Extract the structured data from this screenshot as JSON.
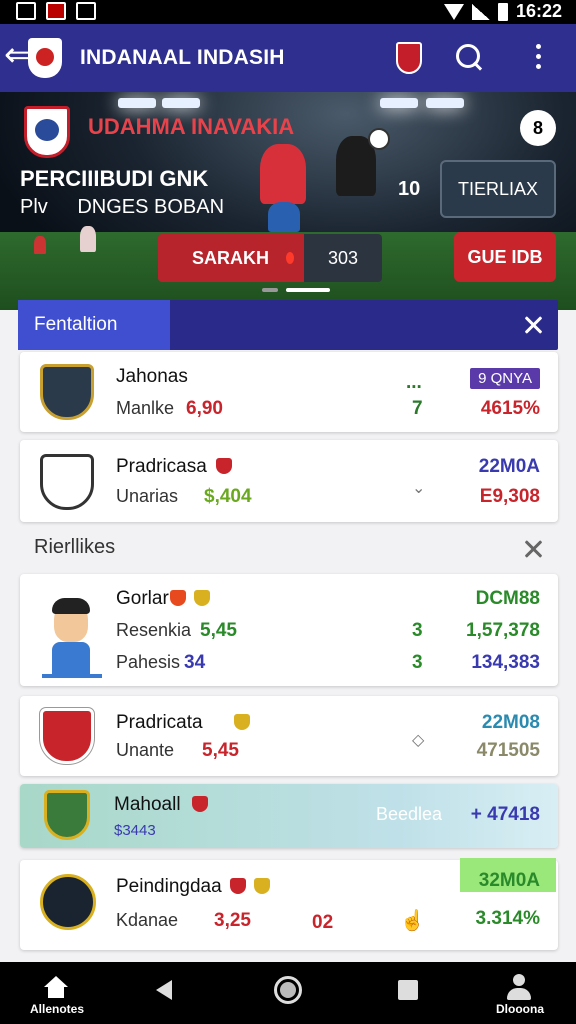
{
  "status_bar": {
    "time": "16:22"
  },
  "app_bar": {
    "title": "INDANAAL INDASIH"
  },
  "hero": {
    "title": "UDAHMA INAVAKIA",
    "subtitle": "PERCIIIBUDI GNK",
    "line2_left": "Plv",
    "line2_right": "DNGES BOBAN",
    "badge": "8",
    "count": "10",
    "button_dark": "TIERLIAX",
    "score_label": "SARAKH",
    "score_value": "303",
    "button_red": "GUE IDB"
  },
  "filter": {
    "tab_label": "Fentaltion"
  },
  "featured": [
    {
      "name": "Jahonas",
      "sub_label": "Manlke",
      "sub_value": "6,90",
      "badge": "9 QNYA",
      "mid_top": "...",
      "mid": "7",
      "right": "4615%",
      "crest_color": "#2a3a4a",
      "right_color": "#c8242c"
    },
    {
      "name": "Pradricasa",
      "sub_label": "Unarias",
      "sub_value": "$,404",
      "top_right": "22M0A",
      "right": "E9,308",
      "crest_color": "#ffffff",
      "right_color": "#c8242c"
    }
  ],
  "section": {
    "label": "Rierllikes"
  },
  "list": [
    {
      "name": "Gorlar",
      "row1_label": "Resenkia",
      "row1_value": "5,45",
      "row1_mid": "3",
      "row1_right": "1,57,378",
      "row2_label": "Pahesis",
      "row2_value": "34",
      "row2_mid": "3",
      "row2_right": "134,383",
      "top_right": "DCM88"
    },
    {
      "name": "Pradricata",
      "sub_label": "Unante",
      "sub_value": "5,45",
      "top_right": "22M08",
      "right": "471505"
    },
    {
      "name": "Mahoall",
      "sub_value": "$3443",
      "mid_label": "Beedlea",
      "right": "+ 47418"
    },
    {
      "name": "Peindingdaa",
      "sub_label": "Kdanae",
      "sub_value": "3,25",
      "mid": "02",
      "top_right": "32M0A",
      "right": "3.314%"
    }
  ],
  "nav": {
    "home_label": "Allenotes",
    "profile_label": "Dlooona"
  },
  "colors": {
    "primary": "#2f2f8f",
    "accent_red": "#c8242c",
    "green": "#2a9a2a",
    "purple": "#5a3aa8"
  }
}
